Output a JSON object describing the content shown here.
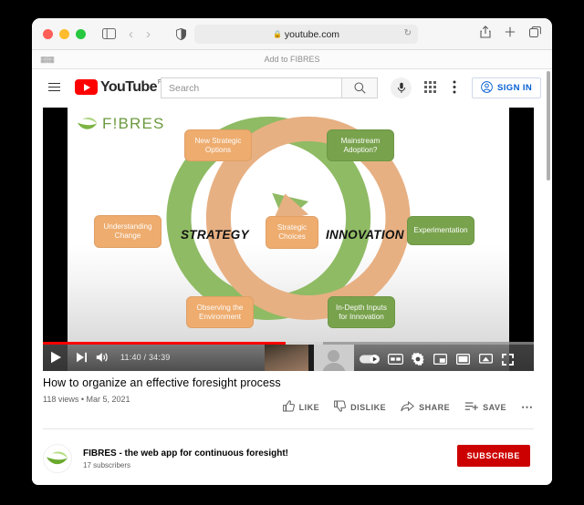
{
  "browser": {
    "traffic_lights": [
      "close",
      "minimize",
      "maximize"
    ],
    "sidebar_icon": "sidebar-icon",
    "back_icon": "chevron-left-icon",
    "forward_icon": "chevron-right-icon",
    "shield_icon": "privacy-shield-icon",
    "url": "youtube.com",
    "lock_icon": "lock-icon",
    "reload_icon": "reload-icon",
    "share_icon": "share-icon",
    "new_tab_icon": "plus-icon",
    "tabs_icon": "tab-overview-icon",
    "bookmarks": {
      "grid_icon": "bookmarks-grid-icon",
      "item_label": "Add to FIBRES"
    }
  },
  "youtube": {
    "menu_icon": "hamburger-menu-icon",
    "logo_word": "YouTube",
    "logo_country": "FI",
    "search": {
      "placeholder": "Search",
      "value": "",
      "search_icon": "search-icon",
      "mic_icon": "microphone-icon"
    },
    "apps_icon": "apps-grid-icon",
    "kebab_icon": "more-vertical-icon",
    "signin_label": "SIGN IN",
    "signin_icon": "account-circle-icon"
  },
  "player": {
    "play_icon": "play-icon",
    "next_icon": "next-track-icon",
    "volume_icon": "volume-icon",
    "time_current": "11:40",
    "time_total": "34:39",
    "time_display": "11:40 / 34:39",
    "progress_played_percent": 49.5,
    "progress_loaded_percent": 57,
    "autoplay_icon": "autoplay-toggle-icon",
    "cc_icon": "closed-captions-icon",
    "settings_icon": "gear-icon",
    "miniplayer_icon": "miniplayer-icon",
    "theater_icon": "theater-mode-icon",
    "cast_icon": "cast-icon",
    "fullscreen_icon": "fullscreen-icon"
  },
  "slide": {
    "logo_text": "F!BRES",
    "logo_icon": "fibres-leaf-icon",
    "center_left_label": "STRATEGY",
    "center_right_label": "INNOVATION",
    "colors": {
      "green": "#78a24c",
      "green_ring": "#8fbb64",
      "orange": "#eeac6e",
      "orange_ring": "#e7b083"
    },
    "nodes": [
      {
        "id": "new-strategic-options",
        "label": "New Strategic Options",
        "color": "orange"
      },
      {
        "id": "understanding-change",
        "label": "Understanding Change",
        "color": "orange"
      },
      {
        "id": "strategic-choices",
        "label": "Strategic Choices",
        "color": "orange"
      },
      {
        "id": "observing-the-environment",
        "label": "Observing the Environment",
        "color": "orange"
      },
      {
        "id": "mainstream-adoption",
        "label": "Mainstream Adoption?",
        "color": "green"
      },
      {
        "id": "experimentation",
        "label": "Experimentation",
        "color": "green"
      },
      {
        "id": "in-depth-inputs-for-innovation",
        "label": "In-Depth Inputs for Innovation",
        "color": "green"
      }
    ]
  },
  "video": {
    "title": "How to organize an effective foresight process",
    "views": "118 views",
    "date": "Mar 5, 2021",
    "meta_line": "118 views • Mar 5, 2021",
    "actions": [
      {
        "id": "like",
        "label": "LIKE",
        "icon": "thumbs-up-icon"
      },
      {
        "id": "dislike",
        "label": "DISLIKE",
        "icon": "thumbs-down-icon"
      },
      {
        "id": "share",
        "label": "SHARE",
        "icon": "share-arrow-icon"
      },
      {
        "id": "save",
        "label": "SAVE",
        "icon": "save-playlist-icon"
      }
    ],
    "more_actions_icon": "ellipsis-icon"
  },
  "channel": {
    "avatar_icon": "fibres-leaf-avatar",
    "name": "FIBRES - the web app for continuous foresight!",
    "subscribers": "17 subscribers",
    "subscribe_label": "SUBSCRIBE",
    "subscribe_color": "#cc0000"
  }
}
